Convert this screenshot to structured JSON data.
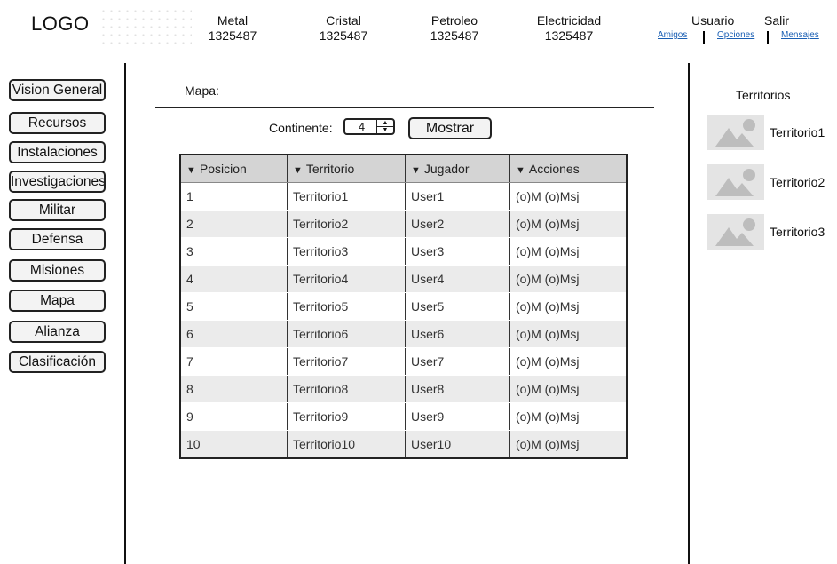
{
  "header": {
    "logo": "LOGO",
    "resources": [
      {
        "name": "Metal",
        "value": "1325487"
      },
      {
        "name": "Cristal",
        "value": "1325487"
      },
      {
        "name": "Petroleo",
        "value": "1325487"
      },
      {
        "name": "Electricidad",
        "value": "1325487"
      }
    ],
    "user": "Usuario",
    "logout": "Salir",
    "links": {
      "friends": "Amigos",
      "options": "Opciones",
      "messages": "Mensajes"
    }
  },
  "sidebar": {
    "items": [
      {
        "label": "Vision General"
      },
      {
        "label": "Recursos"
      },
      {
        "label": "Instalaciones"
      },
      {
        "label": "Investigaciones"
      },
      {
        "label": "Militar"
      },
      {
        "label": "Defensa"
      },
      {
        "label": "Misiones"
      },
      {
        "label": "Mapa"
      },
      {
        "label": "Alianza"
      },
      {
        "label": "Clasificación"
      }
    ]
  },
  "main": {
    "section_label": "Mapa:",
    "continent_label": "Continente:",
    "continent_value": "4",
    "show_button": "Mostrar",
    "table": {
      "headers": [
        "Posicion",
        "Territorio",
        "Jugador",
        "Acciones"
      ],
      "rows": [
        [
          "1",
          "Territorio1",
          "User1",
          "(o)M (o)Msj"
        ],
        [
          "2",
          "Territorio2",
          "User2",
          "(o)M (o)Msj"
        ],
        [
          "3",
          "Territorio3",
          "User3",
          "(o)M (o)Msj"
        ],
        [
          "4",
          "Territorio4",
          "User4",
          "(o)M (o)Msj"
        ],
        [
          "5",
          "Territorio5",
          "User5",
          "(o)M (o)Msj"
        ],
        [
          "6",
          "Territorio6",
          "User6",
          "(o)M (o)Msj"
        ],
        [
          "7",
          "Territorio7",
          "User7",
          "(o)M (o)Msj"
        ],
        [
          "8",
          "Territorio8",
          "User8",
          "(o)M (o)Msj"
        ],
        [
          "9",
          "Territorio9",
          "User9",
          "(o)M (o)Msj"
        ],
        [
          "10",
          "Territorio10",
          "User10",
          "(o)M (o)Msj"
        ]
      ]
    }
  },
  "right_panel": {
    "title": "Territorios",
    "items": [
      {
        "label": "Territorio1",
        "icon": "image-placeholder-icon"
      },
      {
        "label": "Territorio2",
        "icon": "image-placeholder-icon"
      },
      {
        "label": "Territorio3",
        "icon": "image-placeholder-icon"
      }
    ]
  }
}
